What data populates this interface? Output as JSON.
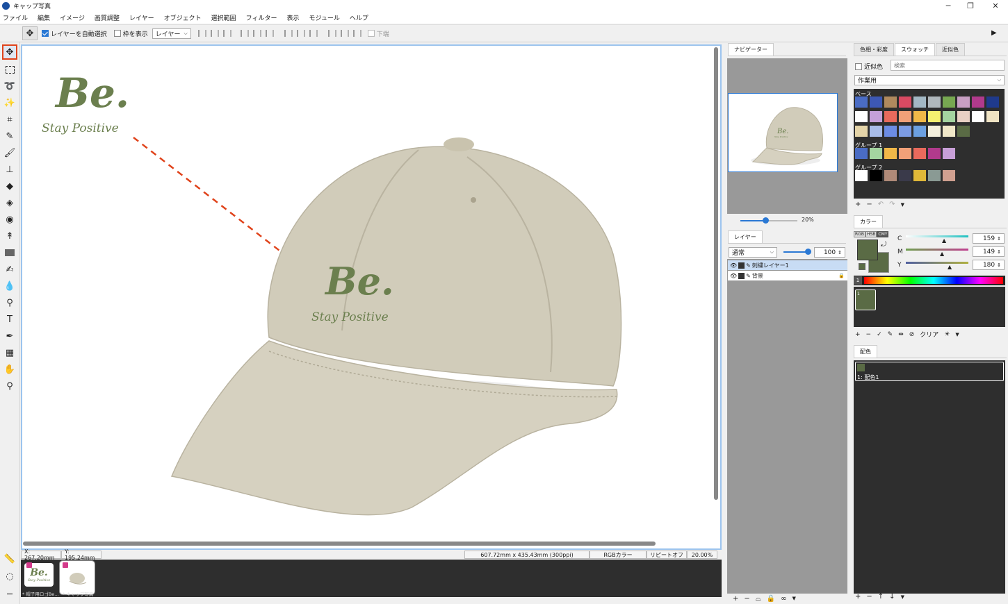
{
  "window": {
    "title": "キャップ写真",
    "controls": [
      "─",
      "❐",
      "✕"
    ]
  },
  "menu": [
    "ファイル",
    "編集",
    "イメージ",
    "画質調整",
    "レイヤー",
    "オブジェクト",
    "選択範囲",
    "フィルター",
    "表示",
    "モジュール",
    "ヘルプ"
  ],
  "options": {
    "auto_select_label": "レイヤーを自動選択",
    "auto_select_checked": true,
    "show_frame_label": "枠を表示",
    "select_value": "レイヤー",
    "bottom_label": "下端"
  },
  "canvas": {
    "logo_text": "Be.",
    "logo_sub": "Stay Positive",
    "cap_logo_text": "Be.",
    "cap_logo_sub": "Stay Positive",
    "cap_color": "#d1ccba",
    "logo_color": "#6b7f4e"
  },
  "status": {
    "x": "X: 267.20mm",
    "y": "Y: 195.24mm",
    "size": "607.72mm x 435.43mm (300ppi)",
    "color_mode": "RGBカラー",
    "repeat": "リピートオフ",
    "zoom": "20.00%"
  },
  "filmstrip": [
    {
      "label": "* 帽子用ロゴBe...",
      "logo": "Be.",
      "logo_sub": "Stay Positive"
    },
    {
      "label": "* キャップ写真"
    }
  ],
  "navigator": {
    "tab": "ナビゲーター",
    "zoom": "20%",
    "zoom_level": 0.2,
    "thumb_logo": "Be.",
    "thumb_sub": "Stay Positive"
  },
  "layers": {
    "tab": "レイヤー",
    "blend": "通常",
    "opacity": "100",
    "items": [
      {
        "name": "刺繍レイヤー1",
        "selected": true
      },
      {
        "name": "背景",
        "locked": true
      }
    ]
  },
  "swatch_panel": {
    "tabs": [
      "色相・彩度",
      "スウォッチ",
      "近似色"
    ],
    "active_tab": 1,
    "approx_label": "近似色",
    "search_placeholder": "検索",
    "set_select": "作業用",
    "groups": [
      {
        "name": "ベース",
        "colors": [
          [
            "#4a6cc4",
            "#3d58b4",
            "#b08a5e",
            "#d94a62",
            "#a3b8c4",
            "#b0b8bc",
            "#77a851",
            "#c8a0c4",
            "#b13a8c",
            "#1f3a8c"
          ],
          [
            "#ffffff",
            "#c4a0d8",
            "#e86a5c",
            "#f0a078",
            "#f0b848",
            "#f4f070",
            "#a4d4a0",
            "#e8d0c4",
            "#ffffff",
            "#f0e4c4"
          ],
          [
            "#e4d4a8",
            "#a8bce8",
            "#6c8ce4",
            "#7c9ce4",
            "#6ca0e0",
            "#f4f0dc",
            "#f0e8c8",
            "#5a6b45"
          ]
        ]
      },
      {
        "name": "グループ 1",
        "colors": [
          [
            "#4a6cc4",
            "#a4d4a0",
            "#f0b848",
            "#f0a078",
            "#e86a5c",
            "#b13a8c",
            "#c8a0d8"
          ]
        ]
      },
      {
        "name": "グループ 2",
        "colors": [
          [
            "#ffffff",
            "#000000",
            "#b08a78",
            "#3a3a4a",
            "#e0b838",
            "#8a9a94",
            "#d0a090"
          ]
        ]
      }
    ]
  },
  "color_panel": {
    "tab": "カラー",
    "modes": [
      "RGB",
      "HSB",
      "CMY"
    ],
    "active_mode": "CMY",
    "c_label": "C",
    "c_value": "159",
    "m_label": "M",
    "m_value": "149",
    "y_label": "Y",
    "y_value": "180",
    "fg": "#5a6b45",
    "bg": "#5a6b45",
    "history_index": "1",
    "history_color": "#5a6b45",
    "clear_label": "クリア"
  },
  "scheme_panel": {
    "tab": "配色",
    "items": [
      {
        "label": "1: 配色1",
        "color": "#5a6b45"
      }
    ]
  }
}
